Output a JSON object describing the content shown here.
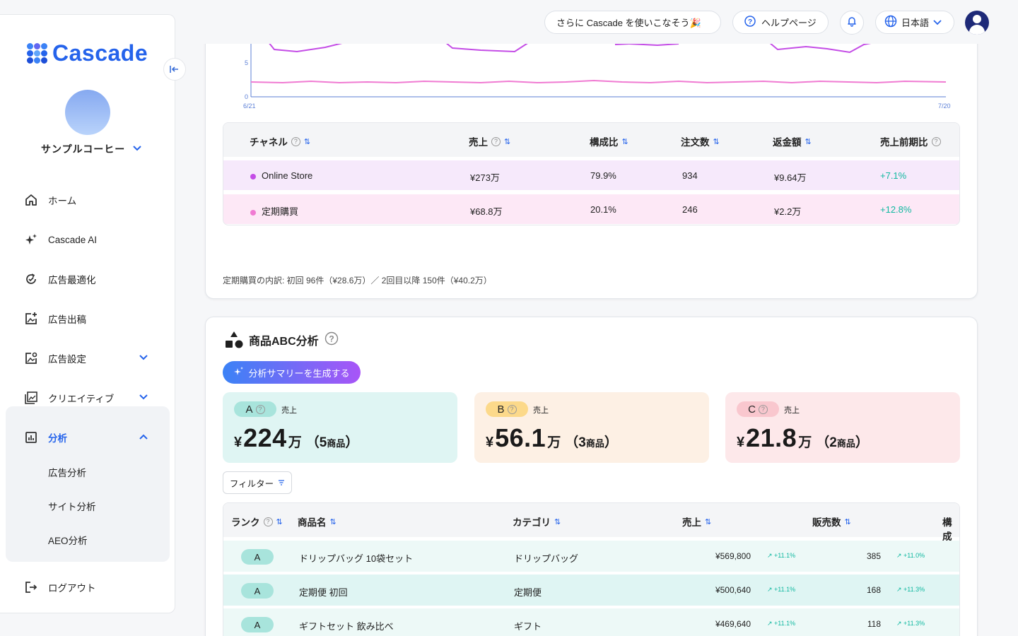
{
  "sidebar": {
    "logo_text": "Cascade",
    "shop_name": "サンプルコーヒー",
    "nav": {
      "home": "ホーム",
      "ai": "Cascade AI",
      "ad_opt": "広告最適化",
      "ad_post": "広告出稿",
      "ad_settings": "広告設定",
      "creative": "クリエイティブ",
      "analysis": "分析",
      "ad_analysis": "広告分析",
      "site_analysis": "サイト分析",
      "aeo_analysis": "AEO分析",
      "logout": "ログアウト"
    }
  },
  "topbar": {
    "promo": "さらに Cascade を使いこなそう🎉",
    "help": "ヘルプページ",
    "language": "日本語"
  },
  "channel_chart": {
    "y_ticks": [
      "5",
      "0"
    ],
    "x_start": "6/21",
    "x_end": "7/20"
  },
  "channel_table": {
    "headers": [
      "チャネル",
      "売上",
      "構成比",
      "注文数",
      "返金額",
      "売上前期比"
    ],
    "rows": [
      {
        "channel": "Online Store",
        "color": "#c44de6",
        "sales": "¥273万",
        "share": "79.9%",
        "orders": "934",
        "refund": "¥9.64万",
        "growth": "+7.1%"
      },
      {
        "channel": "定期購買",
        "color": "#f07bd2",
        "sales": "¥68.8万",
        "share": "20.1%",
        "orders": "246",
        "refund": "¥2.2万",
        "growth": "+12.8%"
      }
    ],
    "note": "定期購買の内訳: 初回 96件（¥28.6万）／ 2回目以降 150件（¥40.2万）"
  },
  "abc": {
    "title": "商品ABC分析",
    "generate_button": "分析サマリーを生成する",
    "filter_button": "フィルター",
    "cards": [
      {
        "rank": "A",
        "label": "売上",
        "yen": "¥",
        "value": "224",
        "unit": "万",
        "count_open": "（",
        "count": "5",
        "count_unit": "商品",
        "count_close": "）",
        "bg": "#dff5f3",
        "pill": "#a8e4dc"
      },
      {
        "rank": "B",
        "label": "売上",
        "yen": "¥",
        "value": "56.1",
        "unit": "万",
        "count_open": "（",
        "count": "3",
        "count_unit": "商品",
        "count_close": "）",
        "bg": "#fdf0e4",
        "pill": "#fcd98a"
      },
      {
        "rank": "C",
        "label": "売上",
        "yen": "¥",
        "value": "21.8",
        "unit": "万",
        "count_open": "（",
        "count": "2",
        "count_unit": "商品",
        "count_close": "）",
        "bg": "#fde8ea",
        "pill": "#f9c7ce"
      }
    ],
    "table_headers": [
      "ランク",
      "商品名",
      "カテゴリ",
      "売上",
      "販売数",
      "構成"
    ],
    "rows": [
      {
        "rank": "A",
        "name": "ドリップバッグ 10袋セット",
        "category": "ドリップバッグ",
        "sales": "¥569,800",
        "sales_delta": "↗ +11.1%",
        "qty": "385",
        "qty_delta": "↗ +11.0%"
      },
      {
        "rank": "A",
        "name": "定期便 初回",
        "category": "定期便",
        "sales": "¥500,640",
        "sales_delta": "↗ +11.1%",
        "qty": "168",
        "qty_delta": "↗ +11.3%"
      },
      {
        "rank": "A",
        "name": "ギフトセット 飲み比べ",
        "category": "ギフト",
        "sales": "¥469,640",
        "sales_delta": "↗ +11.1%",
        "qty": "118",
        "qty_delta": "↗ +11.3%"
      }
    ]
  }
}
